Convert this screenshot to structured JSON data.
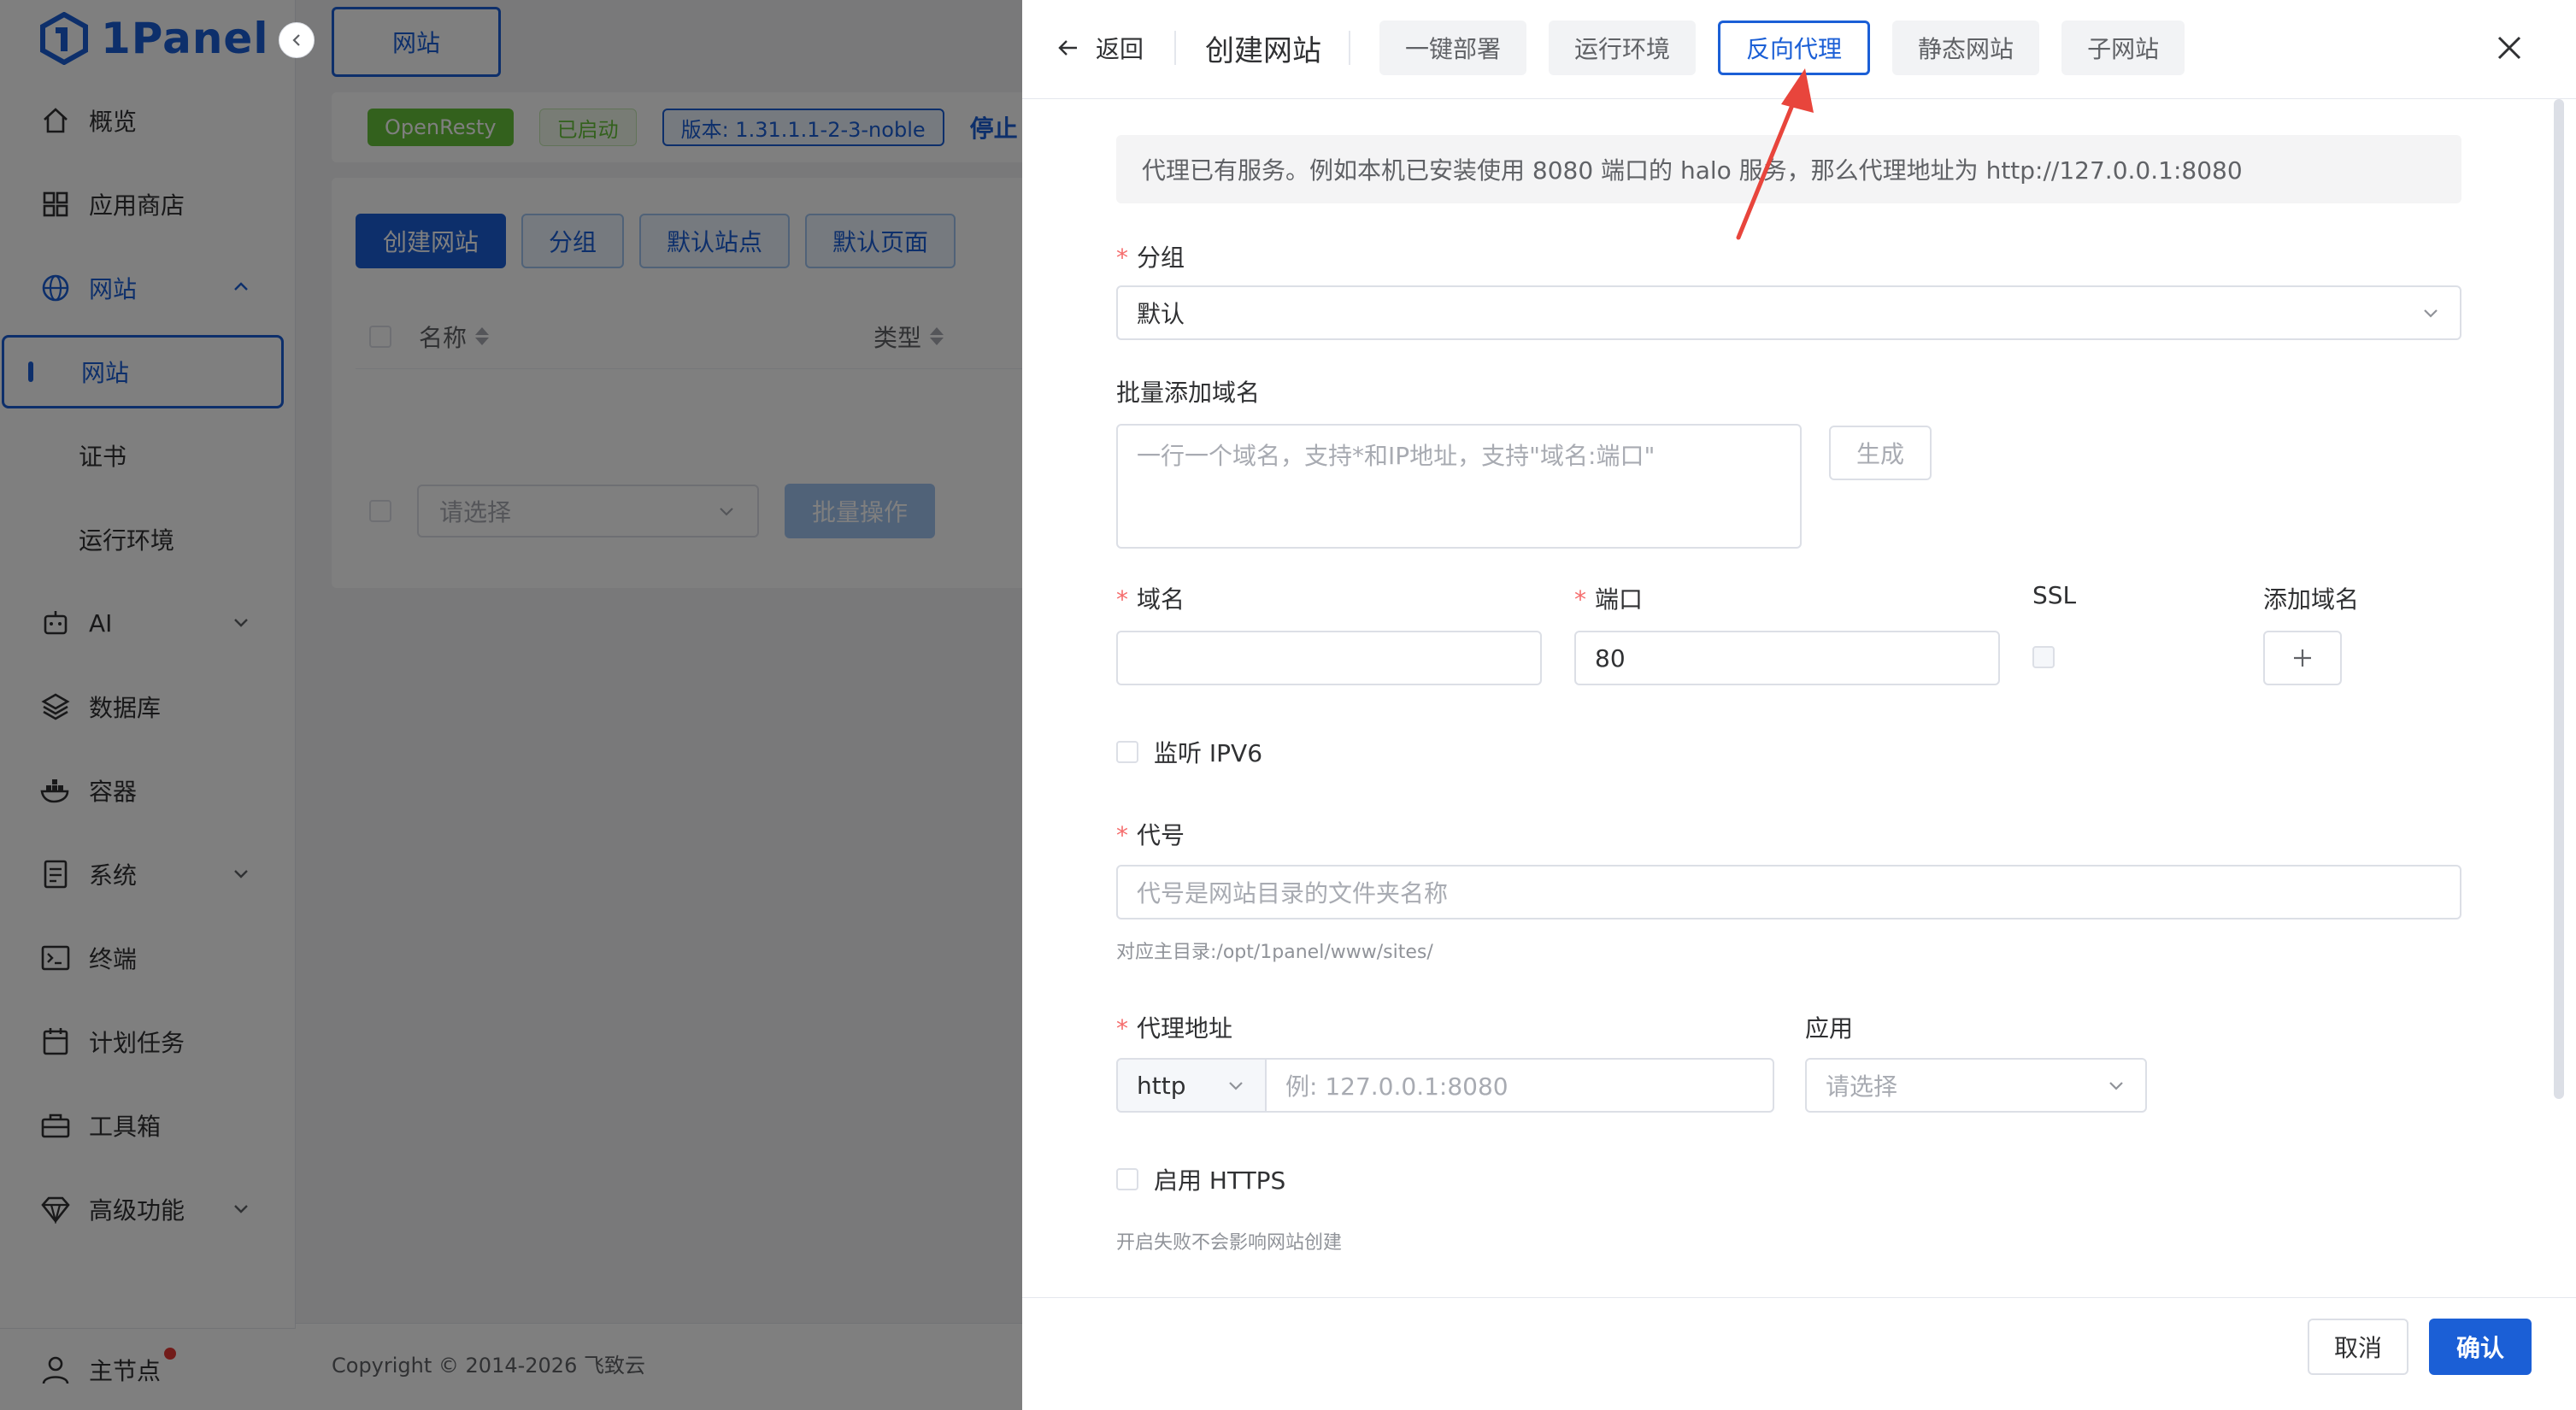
{
  "app": {
    "logo_text": "1Panel"
  },
  "sidebar": {
    "items": [
      {
        "label": "概览",
        "icon": "home-icon"
      },
      {
        "label": "应用商店",
        "icon": "grid-icon"
      },
      {
        "label": "网站",
        "icon": "globe-icon",
        "expanded": true
      },
      {
        "label": "网站",
        "sub": true,
        "active": true
      },
      {
        "label": "证书",
        "sub": true
      },
      {
        "label": "运行环境",
        "sub": true
      },
      {
        "label": "AI",
        "icon": "robot-icon",
        "collapsed": true
      },
      {
        "label": "数据库",
        "icon": "layers-icon"
      },
      {
        "label": "容器",
        "icon": "docker-icon"
      },
      {
        "label": "系统",
        "icon": "server-icon",
        "collapsed": true
      },
      {
        "label": "终端",
        "icon": "terminal-icon"
      },
      {
        "label": "计划任务",
        "icon": "calendar-icon"
      },
      {
        "label": "工具箱",
        "icon": "toolbox-icon"
      },
      {
        "label": "高级功能",
        "icon": "diamond-icon",
        "collapsed": true
      }
    ],
    "node_label": "主节点"
  },
  "main": {
    "tab": "网站",
    "status": {
      "engine": "OpenResty",
      "state": "已启动",
      "version": "版本: 1.31.1.1-2-3-noble",
      "stop": "停止"
    },
    "buttons": {
      "create": "创建网站",
      "group": "分组",
      "default_site": "默认站点",
      "default_page": "默认页面"
    },
    "table": {
      "col_name": "名称",
      "col_type": "类型"
    },
    "batch": {
      "placeholder": "请选择",
      "action": "批量操作"
    },
    "copyright": "Copyright © 2014-2026 飞致云"
  },
  "drawer": {
    "back": "返回",
    "title": "创建网站",
    "tabs": [
      {
        "label": "一键部署",
        "active": false
      },
      {
        "label": "运行环境",
        "active": false
      },
      {
        "label": "反向代理",
        "active": true
      },
      {
        "label": "静态网站",
        "active": false
      },
      {
        "label": "子网站",
        "active": false
      }
    ],
    "notice": "代理已有服务。例如本机已安装使用 8080 端口的 halo 服务，那么代理地址为 http://127.0.0.1:8080",
    "group": {
      "label": "分组",
      "value": "默认"
    },
    "batch_domain": {
      "label": "批量添加域名",
      "placeholder": "一行一个域名，支持*和IP地址，支持\"域名:端口\"",
      "generate": "生成"
    },
    "domain": {
      "label": "域名",
      "value": ""
    },
    "port": {
      "label": "端口",
      "value": "80"
    },
    "ssl": {
      "label": "SSL"
    },
    "add_domain": {
      "label": "添加域名"
    },
    "ipv6": {
      "label": "监听 IPV6"
    },
    "alias": {
      "label": "代号",
      "placeholder": "代号是网站目录的文件夹名称",
      "hint": "对应主目录:/opt/1panel/www/sites/"
    },
    "proxy": {
      "label": "代理地址",
      "protocol": "http",
      "placeholder": "例: 127.0.0.1:8080"
    },
    "app": {
      "label": "应用",
      "placeholder": "请选择"
    },
    "https": {
      "label": "启用 HTTPS",
      "hint": "开启失败不会影响网站创建"
    },
    "footer": {
      "cancel": "取消",
      "confirm": "确认"
    }
  },
  "colors": {
    "accent": "#1b5fd6",
    "required": "#f56c6c",
    "annotation_arrow": "#e8453c"
  }
}
